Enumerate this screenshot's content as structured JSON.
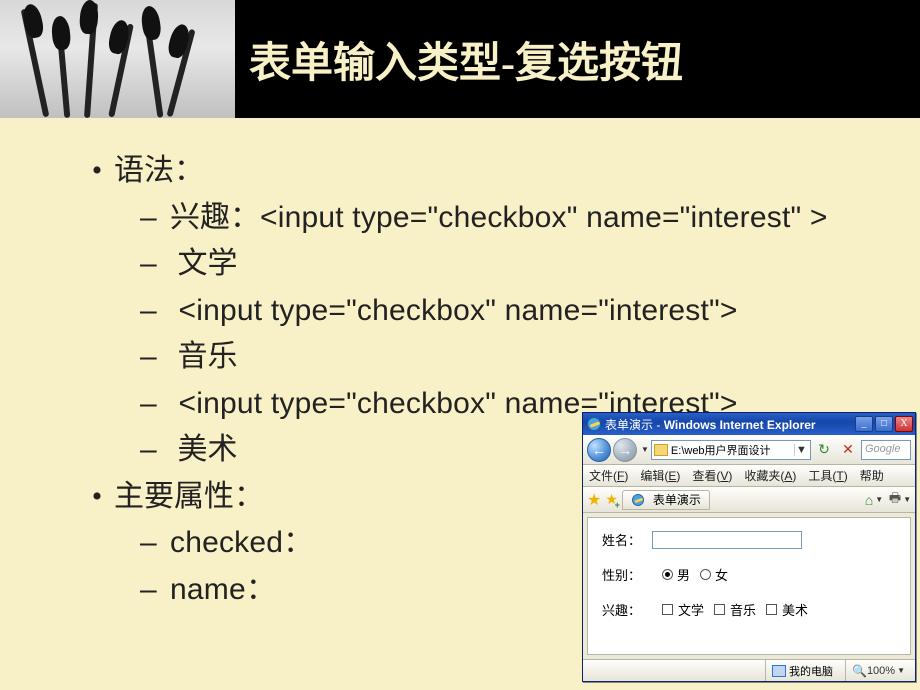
{
  "slide": {
    "title": "表单输入类型-复选按钮",
    "section_syntax": "语法：",
    "items": [
      "兴趣：<input type=\"checkbox\" name=\"interest\" >",
      " 文学",
      " <input type=\"checkbox\" name=\"interest\">",
      " 音乐",
      " <input type=\"checkbox\" name=\"interest\">",
      " 美术"
    ],
    "section_attrs": "主要属性：",
    "attrs": [
      "checked：",
      "name："
    ]
  },
  "ie": {
    "titlebar_page": "表单演示",
    "titlebar_sep": " - ",
    "titlebar_app": "Windows Internet Explorer",
    "addr": "E:\\web用户界面设计",
    "search_placeholder": "Google",
    "menu": {
      "file": "文件(F)",
      "edit": "编辑(E)",
      "view": "查看(V)",
      "fav": "收藏夹(A)",
      "tools": "工具(T)",
      "help": "帮助"
    },
    "tab": "表单演示",
    "form": {
      "name_label": "姓名：",
      "gender_label": "性别：",
      "gender_male": "男",
      "gender_female": "女",
      "interest_label": "兴趣：",
      "interest_lit": "文学",
      "interest_music": "音乐",
      "interest_art": "美术"
    },
    "status": {
      "mycomputer": "我的电脑",
      "zoom": "100%"
    },
    "win_buttons": {
      "min": "_",
      "max": "□",
      "close": "X"
    },
    "nav": {
      "back": "←",
      "fwd": "→"
    }
  }
}
